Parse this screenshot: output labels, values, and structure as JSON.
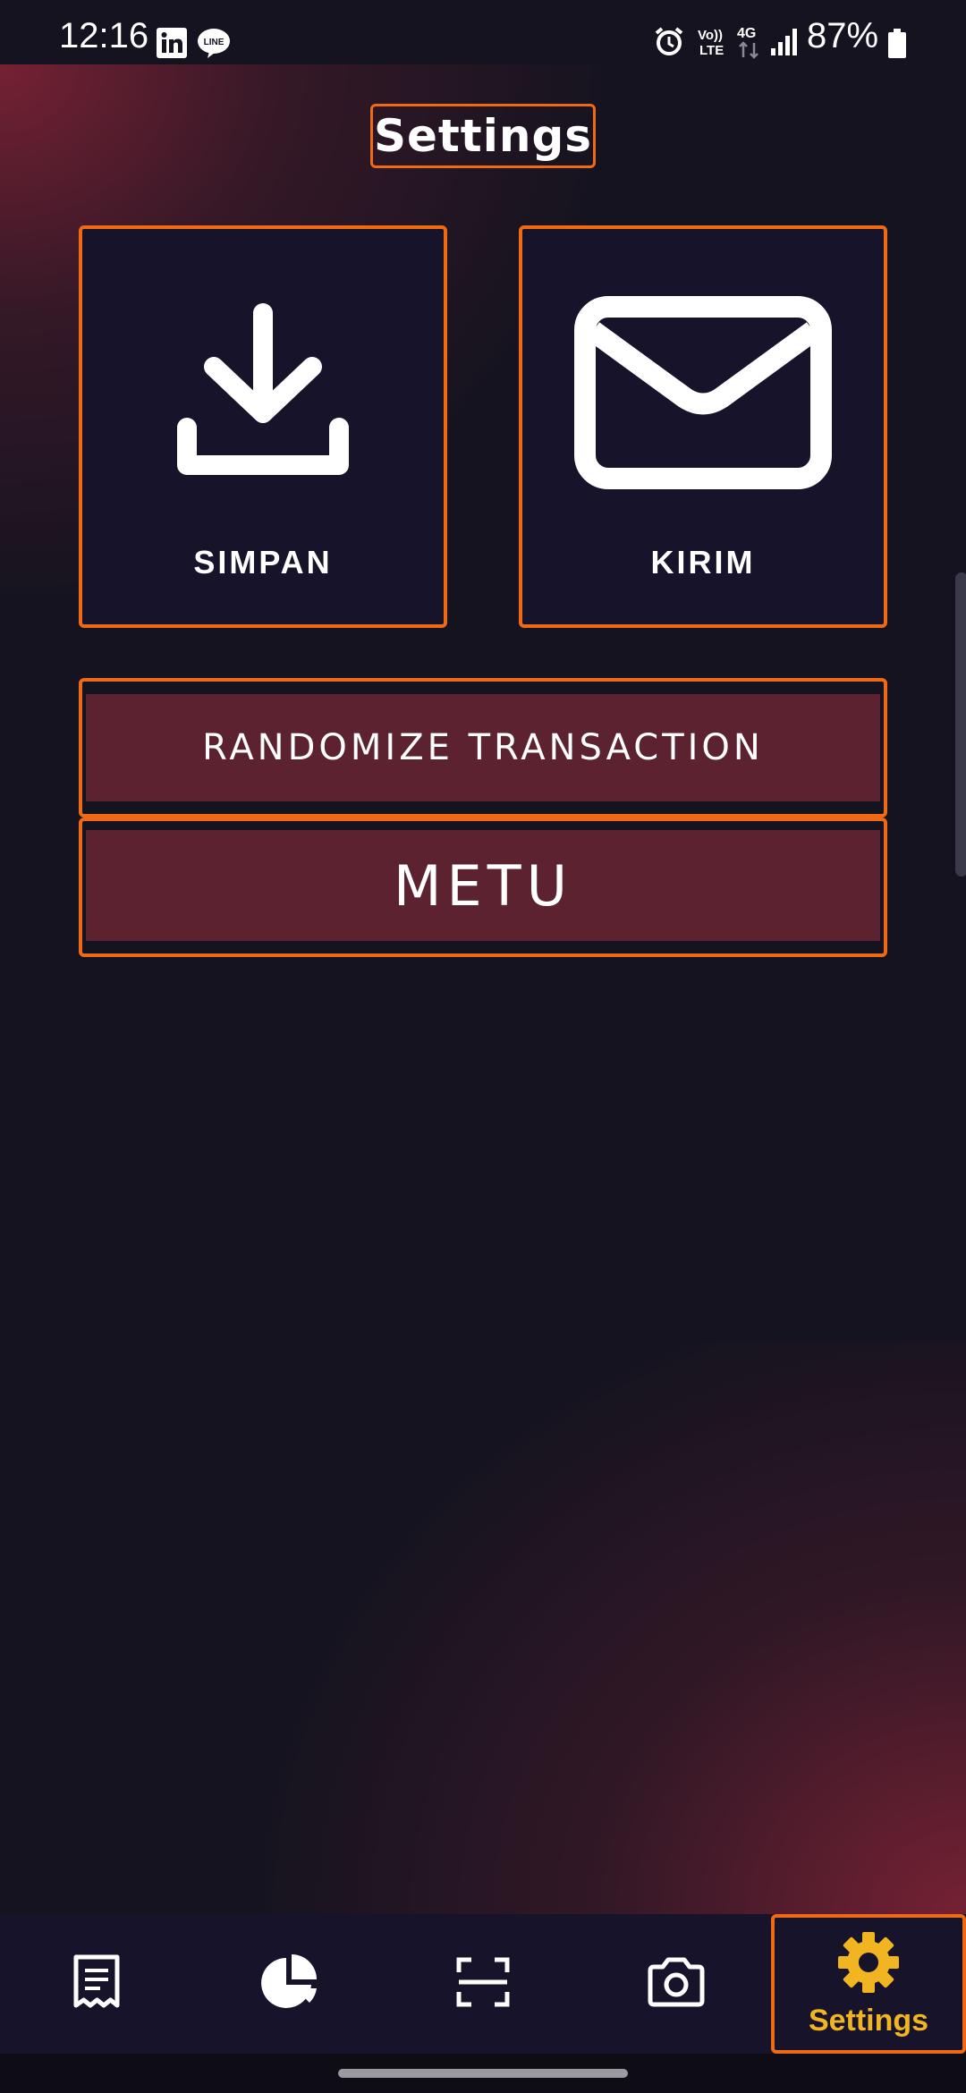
{
  "status_bar": {
    "time": "12:16",
    "battery": "87%",
    "network": "4G",
    "volte": "Vo)) LTE",
    "icons": [
      "linkedin-icon",
      "line-icon",
      "alarm-icon",
      "signal-icon",
      "battery-icon"
    ]
  },
  "header": {
    "title": "Settings"
  },
  "tiles": [
    {
      "label": "SIMPAN",
      "icon": "download-icon"
    },
    {
      "label": "KIRIM",
      "icon": "mail-icon"
    }
  ],
  "actions": {
    "randomize_label": "RANDOMIZE TRANSACTION",
    "metu_label": "METU"
  },
  "bottom_nav": {
    "items": [
      {
        "icon": "receipt-icon"
      },
      {
        "icon": "pie-chart-icon"
      },
      {
        "icon": "scan-icon"
      },
      {
        "icon": "camera-icon"
      },
      {
        "icon": "gear-icon",
        "label": "Settings",
        "active": true
      }
    ]
  },
  "colors": {
    "background": "#14131f",
    "accent_outline": "#f06a15",
    "button_fill": "#5c2230",
    "active_nav": "#f0b520",
    "gradient": "#7a2234"
  }
}
